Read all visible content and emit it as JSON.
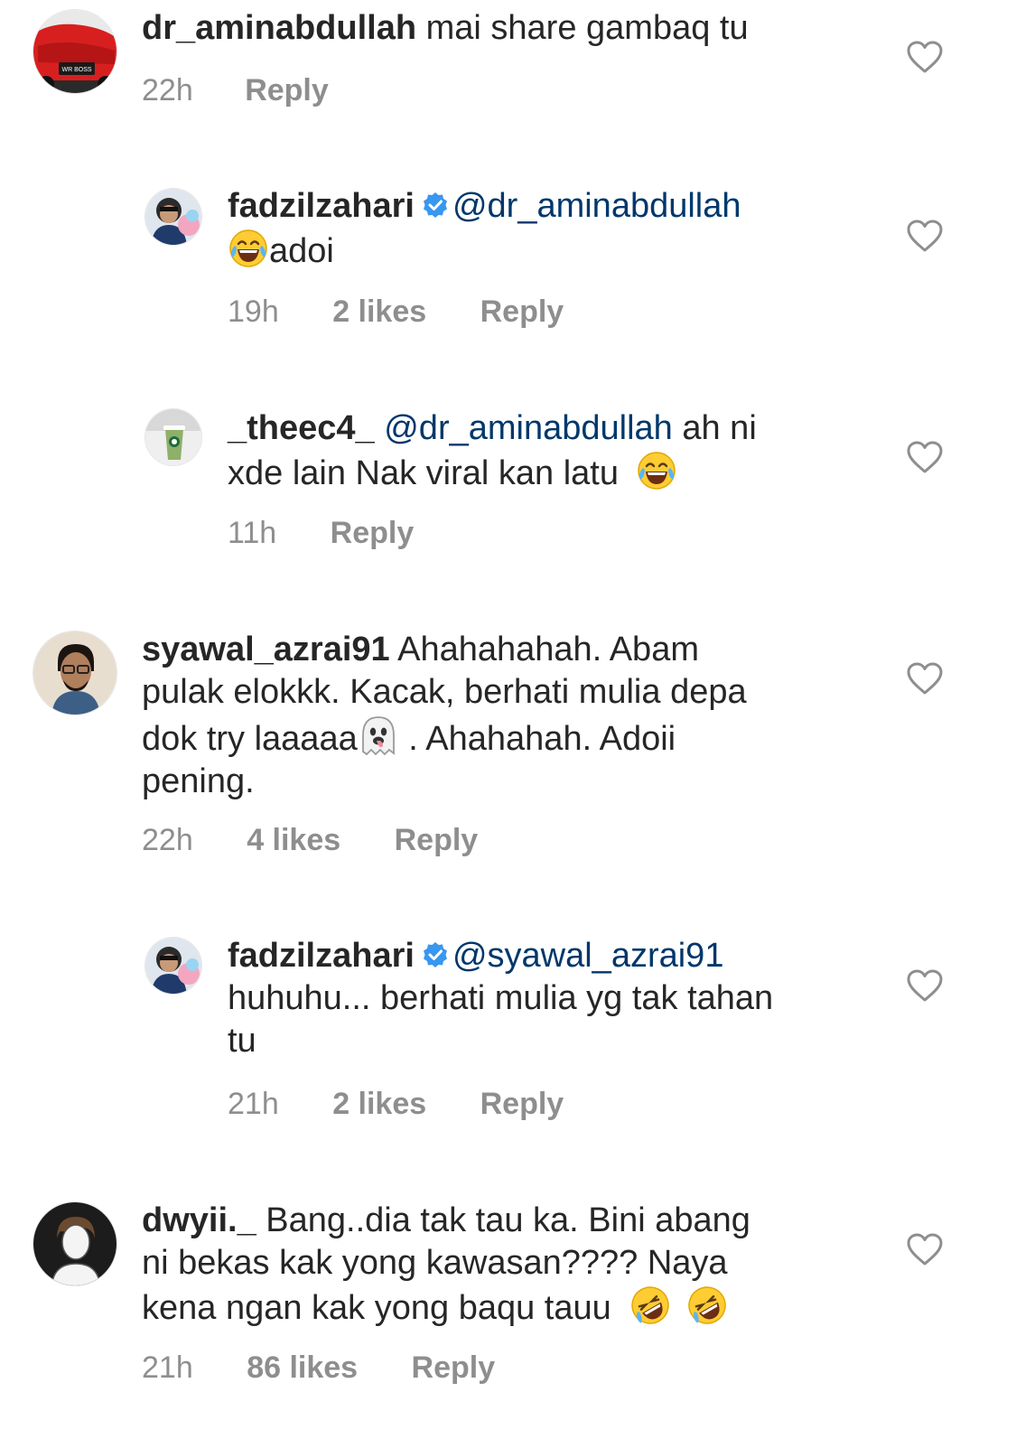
{
  "comments": [
    {
      "username": "dr_aminabdullah",
      "text": "mai share gambaq tu",
      "time": "22h",
      "reply_label": "Reply",
      "avatar_plate": "WR BOSS"
    },
    {
      "username": "fadzilzahari",
      "mention": "@dr_aminabdullah",
      "text": "adoi",
      "time": "19h",
      "likes": "2 likes",
      "reply_label": "Reply"
    },
    {
      "username": "_theec4_",
      "mention": "@dr_aminabdullah",
      "text_a": "ah ni",
      "text_b": "xde lain Nak viral kan latu",
      "time": "11h",
      "reply_label": "Reply"
    },
    {
      "username": "syawal_azrai91",
      "line1": "Ahahahahah. Abam",
      "line2": "pulak elokkk. Kacak, berhati mulia depa",
      "line3a": "dok try laaaaa",
      "line3b": " . Ahahahah. Adoii",
      "line4": "pening.",
      "time": "22h",
      "likes": "4 likes",
      "reply_label": "Reply"
    },
    {
      "username": "fadzilzahari",
      "mention": "@syawal_azrai91",
      "line2": "huhuhu... berhati mulia yg tak tahan",
      "line3": "tu",
      "time": "21h",
      "likes": "2 likes",
      "reply_label": "Reply"
    },
    {
      "username": "dwyii._",
      "line1": "Bang..dia tak tau ka. Bini abang",
      "line2": "ni bekas kak yong kawasan???? Naya",
      "line3": "kena ngan kak yong baqu tauu",
      "time": "21h",
      "likes": "86 likes",
      "reply_label": "Reply"
    }
  ],
  "icons": {
    "like": "heart-outline-icon",
    "verified": "verified-badge-icon",
    "laugh": "face-with-tears-of-joy-emoji",
    "ghost": "ghost-tongue-emoji",
    "rofl": "rolling-on-floor-laughing-emoji"
  },
  "colors": {
    "text": "#262626",
    "meta": "#8e8e8e",
    "mention": "#00376b",
    "verified": "#3897f0"
  }
}
